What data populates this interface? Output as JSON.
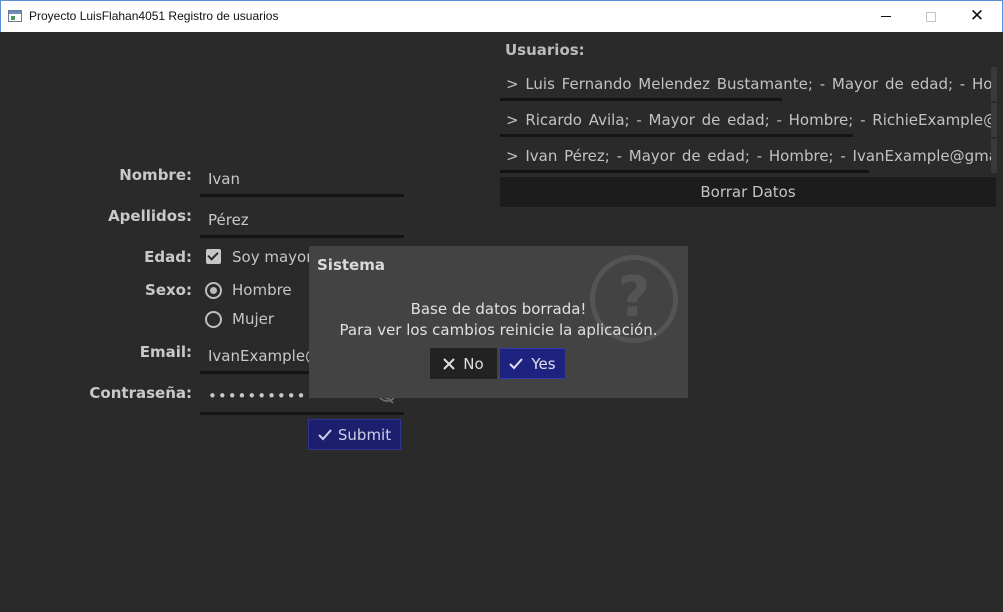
{
  "window": {
    "title": "Proyecto LuisFlahan4051 Registro de usuarios"
  },
  "form": {
    "nombre_label": "Nombre:",
    "nombre_value": "Ivan",
    "apellidos_label": "Apellidos:",
    "apellidos_value": "Pérez",
    "edad_label": "Edad:",
    "edad_checkbox_label": "Soy mayor",
    "sexo_label": "Sexo:",
    "sexo_options": [
      "Hombre",
      "Mujer"
    ],
    "email_label": "Email:",
    "email_value": "IvanExample@",
    "password_label": "Contraseña:",
    "password_value": "••••••••••",
    "submit_label": "Submit"
  },
  "users": {
    "title": "Usuarios:",
    "rows": [
      "> Luis Fernando Melendez Bustamante;  -  Mayor de edad;  -  Hombre;",
      "> Ricardo Avila;  -  Mayor de edad;  -  Hombre;  -  RichieExample@",
      "> Ivan Pérez;  -  Mayor de edad;  -  Hombre;  -  IvanExample@gmail"
    ],
    "clear_label": "Borrar Datos"
  },
  "dialog": {
    "title": "Sistema",
    "message_line1": "Base de datos borrada!",
    "message_line2": "Para ver los cambios reinicie la aplicación.",
    "no_label": "No",
    "yes_label": "Yes"
  }
}
